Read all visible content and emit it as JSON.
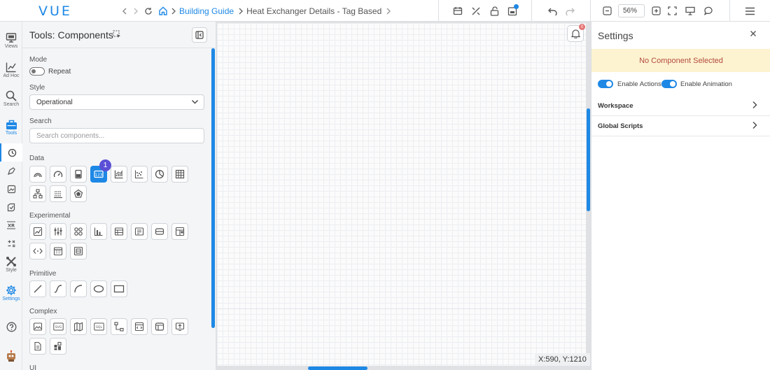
{
  "topbar": {
    "logo": "VUE",
    "breadcrumb": {
      "link": "Building Guide",
      "current": "Heat Exchanger Details - Tag Based"
    },
    "zoom": "56%"
  },
  "rail": {
    "items": [
      {
        "label": "Views",
        "icon": "views-icon"
      },
      {
        "label": "Ad Hoc",
        "icon": "chart-line-icon"
      },
      {
        "label": "Search",
        "icon": "search-icon"
      },
      {
        "label": "Tools",
        "icon": "toolbox-icon"
      },
      {
        "label": "Style",
        "icon": "style-icon"
      },
      {
        "label": "Settings",
        "icon": "gear-icon"
      }
    ]
  },
  "tools": {
    "title": "Tools: Components",
    "mode_label": "Mode",
    "repeat_label": "Repeat",
    "style_label": "Style",
    "style_value": "Operational",
    "search_label": "Search",
    "search_placeholder": "Search components...",
    "sections": {
      "data": "Data",
      "experimental": "Experimental",
      "primitive": "Primitive",
      "complex": "Complex",
      "ui": "UI"
    },
    "badge": "1"
  },
  "canvas": {
    "coords": "X:590, Y:1210",
    "notification_count": "0"
  },
  "settings": {
    "title": "Settings",
    "no_component": "No Component Selected",
    "enable_actions": "Enable Actions",
    "enable_animation": "Enable Animation",
    "rows": [
      "Workspace",
      "Global Scripts"
    ]
  },
  "colors": {
    "accent": "#1e88e5",
    "badge": "#5b4fd6",
    "warning_bg": "#fdf3d0",
    "warning_text": "#b34a3c"
  }
}
